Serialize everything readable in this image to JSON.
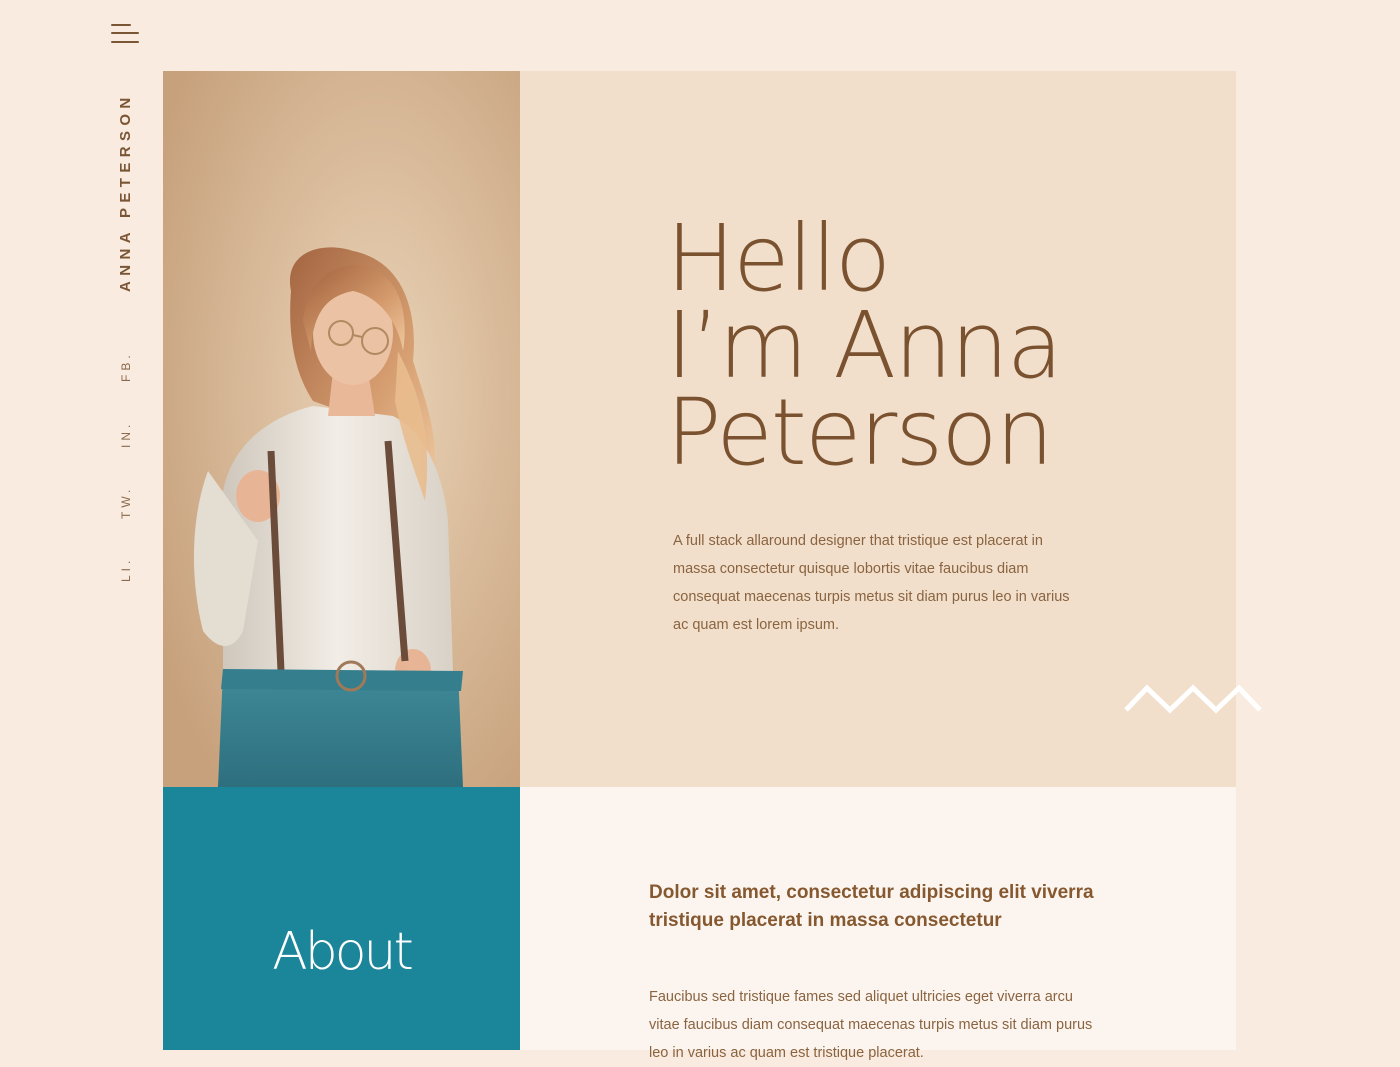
{
  "nav": {
    "menu_icon": "hamburger-menu-icon",
    "name_vertical": "ANNA PETERSON",
    "social": [
      {
        "label": "FB."
      },
      {
        "label": "IN."
      },
      {
        "label": "TW."
      },
      {
        "label": "LI."
      }
    ]
  },
  "hero": {
    "title_lines": [
      "Hello",
      "I’m Anna",
      "Peterson"
    ],
    "description": "A full stack allaround designer that tristique est placerat in massa consectetur quisque lobortis vitae faucibus diam consequat maecenas turpis metus sit diam purus leo in varius ac quam est lorem ipsum.",
    "photo": "portrait-photo",
    "decoration": "zigzag-icon"
  },
  "about": {
    "title": "About",
    "heading": "Dolor sit amet, consectetur adipiscing elit viverra tristique placerat in massa consectetur",
    "body": "Faucibus sed tristique fames sed aliquet ultricies eget viverra arcu vitae faucibus diam consequat maecenas turpis metus sit diam purus leo in varius ac quam est tristique placerat."
  },
  "colors": {
    "page_bg": "#f9ebdf",
    "hero_bg": "#f1dfcc",
    "accent_teal": "#1b8599",
    "text_brown": "#7a5230",
    "content_bg": "#fcf5ef"
  }
}
